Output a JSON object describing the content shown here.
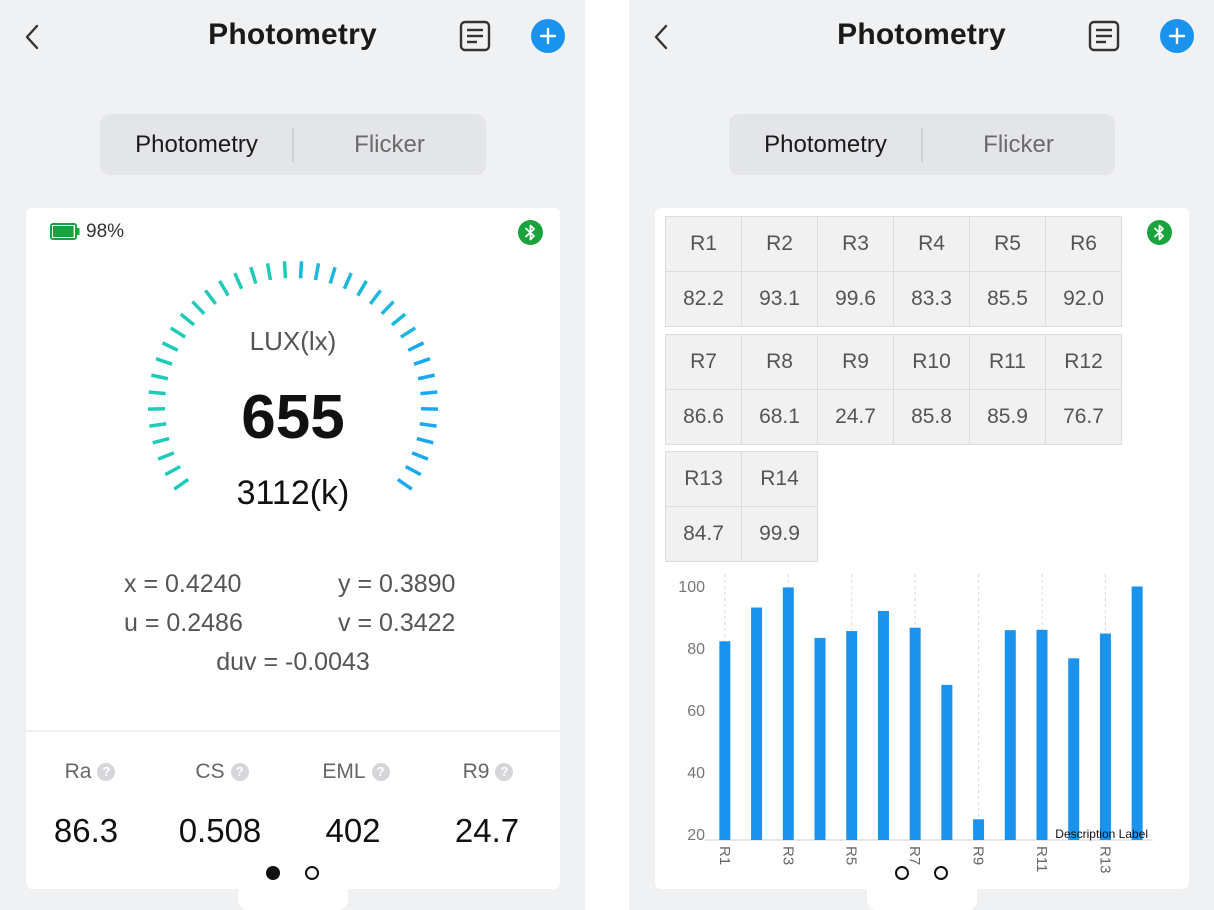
{
  "colors": {
    "accent": "#1a93ee",
    "gauge": "#1ecbb8",
    "bluetooth": "#1aa23c",
    "bar": "#1a93ee",
    "battery": "#1aa23c"
  },
  "left": {
    "header": {
      "title": "Photometry",
      "back_icon": "chevron-left-icon",
      "report_icon": "document-list-icon",
      "add_icon": "plus-icon"
    },
    "tabs": [
      {
        "label": "Photometry",
        "selected": true
      },
      {
        "label": "Flicker",
        "selected": false
      }
    ],
    "battery_percent": "98%",
    "battery_level": 0.98,
    "gauge": {
      "label": "LUX(lx)",
      "value": "655",
      "secondary": "3112(k)"
    },
    "coords": {
      "x": "x = 0.4240",
      "y": "y = 0.3890",
      "u": "u = 0.2486",
      "v": "v = 0.3422",
      "duv": "duv = -0.0043"
    },
    "metrics": [
      {
        "label": "Ra",
        "value": "86.3"
      },
      {
        "label": "CS",
        "value": "0.508"
      },
      {
        "label": "EML",
        "value": "402"
      },
      {
        "label": "R9",
        "value": "24.7"
      }
    ],
    "help_glyph": "?",
    "page_indicator": {
      "current": 1,
      "total": 2
    }
  },
  "right": {
    "header": {
      "title": "Photometry"
    },
    "tabs": [
      {
        "label": "Photometry",
        "selected": true
      },
      {
        "label": "Flicker",
        "selected": false
      }
    ],
    "r_table": [
      [
        {
          "label": "R1",
          "value": "82.2"
        },
        {
          "label": "R2",
          "value": "93.1"
        },
        {
          "label": "R3",
          "value": "99.6"
        },
        {
          "label": "R4",
          "value": "83.3"
        },
        {
          "label": "R5",
          "value": "85.5"
        },
        {
          "label": "R6",
          "value": "92.0"
        }
      ],
      [
        {
          "label": "R7",
          "value": "86.6"
        },
        {
          "label": "R8",
          "value": "68.1"
        },
        {
          "label": "R9",
          "value": "24.7"
        },
        {
          "label": "R10",
          "value": "85.8"
        },
        {
          "label": "R11",
          "value": "85.9"
        },
        {
          "label": "R12",
          "value": "76.7"
        }
      ],
      [
        {
          "label": "R13",
          "value": "84.7"
        },
        {
          "label": "R14",
          "value": "99.9"
        }
      ]
    ],
    "page_indicator": {
      "current": 1,
      "total": 2
    }
  },
  "chart_data": {
    "type": "bar",
    "categories": [
      "R1",
      "R2",
      "R3",
      "R4",
      "R5",
      "R6",
      "R7",
      "R8",
      "R9",
      "R10",
      "R11",
      "R12",
      "R13",
      "R14"
    ],
    "values": [
      82.2,
      93.1,
      99.6,
      83.3,
      85.5,
      92.0,
      86.6,
      68.1,
      24.7,
      85.8,
      85.9,
      76.7,
      84.7,
      99.9
    ],
    "x_tick_labels": [
      "R1",
      "R3",
      "R5",
      "R7",
      "R9",
      "R11",
      "R13"
    ],
    "y_ticks": [
      20,
      40,
      60,
      80,
      100
    ],
    "ylim": [
      18,
      102
    ],
    "annotation": "Description Label",
    "grid": "vertical-dashed"
  }
}
